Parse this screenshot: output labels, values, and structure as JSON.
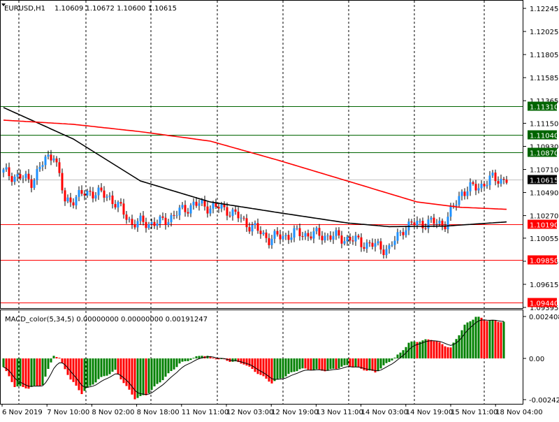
{
  "chart_data": {
    "type": "candlestick",
    "title": "EURUSD,H1",
    "ohlc_header": [
      "1.10609",
      "1.10672",
      "1.10600",
      "1.10615"
    ],
    "ylim": [
      1.09395,
      1.12245
    ],
    "y_ticks": [
      "1.12245",
      "1.12025",
      "1.11805",
      "1.11585",
      "1.11365",
      "1.11150",
      "1.10930",
      "1.10710",
      "1.10490",
      "1.10270",
      "1.10055",
      "1.09835",
      "1.09615",
      "1.09395"
    ],
    "x_ticks": [
      "6 Nov 2019",
      "7 Nov 10:00",
      "8 Nov 02:00",
      "8 Nov 18:00",
      "11 Nov 11:00",
      "12 Nov 03:00",
      "12 Nov 19:00",
      "13 Nov 11:00",
      "14 Nov 03:00",
      "14 Nov 19:00",
      "15 Nov 11:00",
      "18 Nov 04:00"
    ],
    "levels": [
      {
        "label": "1.11310",
        "value": 1.1131,
        "color": "#006400"
      },
      {
        "label": "1.11040",
        "value": 1.1104,
        "color": "#006400"
      },
      {
        "label": "1.10870",
        "value": 1.1087,
        "color": "#006400"
      },
      {
        "label": "1.10615",
        "value": 1.10615,
        "color": "#000000",
        "current": true
      },
      {
        "label": "1.10190",
        "value": 1.1019,
        "color": "#ff0000"
      },
      {
        "label": "1.09850",
        "value": 1.0985,
        "color": "#ff0000"
      },
      {
        "label": "1.09440",
        "value": 1.0944,
        "color": "#ff0000"
      }
    ],
    "price_path": [
      [
        0,
        1.1068
      ],
      [
        10,
        1.106
      ],
      [
        15,
        1.108
      ],
      [
        18,
        1.1087
      ],
      [
        22,
        1.104
      ],
      [
        31,
        1.105
      ],
      [
        38,
        1.1045
      ],
      [
        46,
        1.102
      ],
      [
        56,
        1.102
      ],
      [
        68,
        1.1038
      ],
      [
        80,
        1.1033
      ],
      [
        88,
        1.1018
      ],
      [
        95,
        1.1005
      ],
      [
        105,
        1.101
      ],
      [
        115,
        1.1008
      ],
      [
        123,
        1.1005
      ],
      [
        130,
        1.1
      ],
      [
        138,
        1.0995
      ],
      [
        143,
        1.1015
      ],
      [
        148,
        1.102
      ],
      [
        158,
        1.102
      ],
      [
        164,
        1.105
      ],
      [
        170,
        1.1055
      ],
      [
        175,
        1.1062
      ],
      [
        180,
        1.10615
      ]
    ],
    "ma_black": [
      [
        0,
        1.113
      ],
      [
        25,
        1.11
      ],
      [
        49,
        1.106
      ],
      [
        74,
        1.104
      ],
      [
        98,
        1.103
      ],
      [
        123,
        1.102
      ],
      [
        138,
        1.10165
      ],
      [
        158,
        1.1017
      ],
      [
        180,
        1.1021
      ]
    ],
    "ma_red": [
      [
        0,
        1.1118
      ],
      [
        25,
        1.1114
      ],
      [
        49,
        1.1107
      ],
      [
        74,
        1.1098
      ],
      [
        98,
        1.108
      ],
      [
        123,
        1.106
      ],
      [
        148,
        1.104
      ],
      [
        163,
        1.1035
      ],
      [
        180,
        1.1033
      ]
    ],
    "macd": {
      "label": "MACD_color(5,34,5) 0.00000000 0.00000000 0.00191247",
      "ylim": [
        -0.002427,
        0.0024082
      ],
      "y_ticks": [
        "0.0024082",
        "0.00",
        "-0.002427"
      ],
      "histogram": [
        [
          0,
          -0.0005
        ],
        [
          4,
          -0.0016
        ],
        [
          9,
          -0.0017
        ],
        [
          14,
          -0.0015
        ],
        [
          18,
          0.0002
        ],
        [
          20,
          0.0
        ],
        [
          24,
          -0.0012
        ],
        [
          28,
          -0.002
        ],
        [
          34,
          -0.0012
        ],
        [
          40,
          -0.0007
        ],
        [
          47,
          -0.0023
        ],
        [
          51,
          -0.0021
        ],
        [
          63,
          -0.0003
        ],
        [
          71,
          0.0002
        ],
        [
          76,
          0.0
        ],
        [
          86,
          -0.0003
        ],
        [
          96,
          -0.0014
        ],
        [
          106,
          -0.0006
        ],
        [
          116,
          -0.0007
        ],
        [
          123,
          -0.0004
        ],
        [
          133,
          -0.0008
        ],
        [
          142,
          0.0003
        ],
        [
          145,
          0.0009
        ],
        [
          153,
          0.0011
        ],
        [
          160,
          0.0006
        ],
        [
          165,
          0.0019
        ],
        [
          169,
          0.0024
        ],
        [
          173,
          0.0022
        ],
        [
          179,
          0.0021
        ]
      ],
      "colors": {
        "up": "#008000",
        "down": "#ff0000"
      }
    },
    "colors": {
      "bull": "#1e90ff",
      "bear": "#ff0000",
      "wick": "#000000"
    }
  }
}
